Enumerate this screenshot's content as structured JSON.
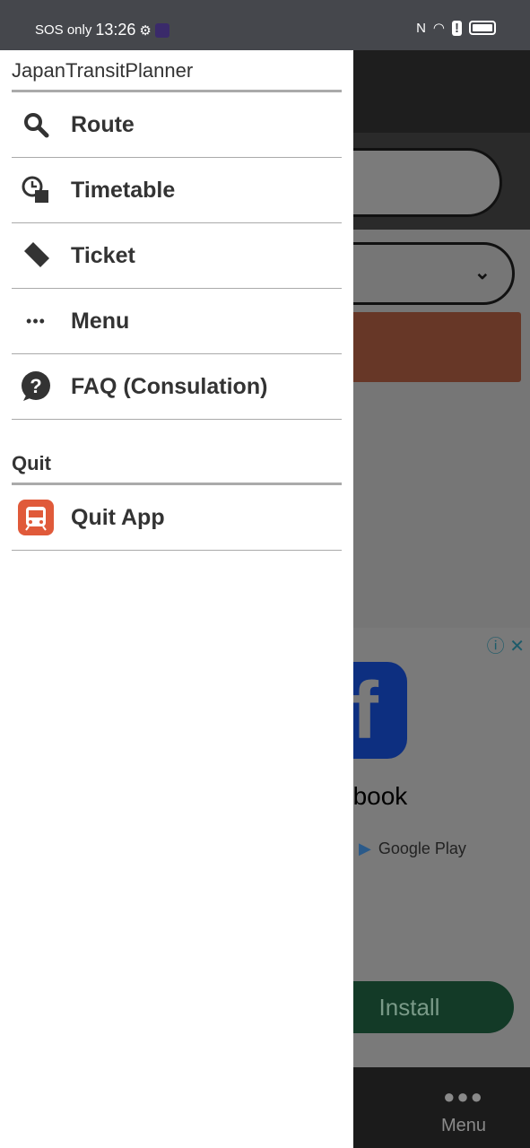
{
  "status_bar": {
    "carrier": "SOS only",
    "time": "13:26"
  },
  "drawer": {
    "title": "JapanTransitPlanner",
    "items": [
      {
        "label": "Route",
        "icon": "search-icon"
      },
      {
        "label": "Timetable",
        "icon": "clock-timetable-icon"
      },
      {
        "label": "Ticket",
        "icon": "ticket-icon"
      },
      {
        "label": "Menu",
        "icon": "more-dots-icon"
      },
      {
        "label": "FAQ (Consulation)",
        "icon": "question-bubble-icon"
      }
    ],
    "quit_section": {
      "title": "Quit",
      "item": {
        "label": "Quit App",
        "icon": "train-icon",
        "icon_color": "#e05a3a"
      }
    }
  },
  "background": {
    "ad": {
      "app_name_partial": "ebook",
      "store": "Google Play",
      "install": "Install"
    },
    "bottom_nav": {
      "menu": "Menu"
    }
  }
}
